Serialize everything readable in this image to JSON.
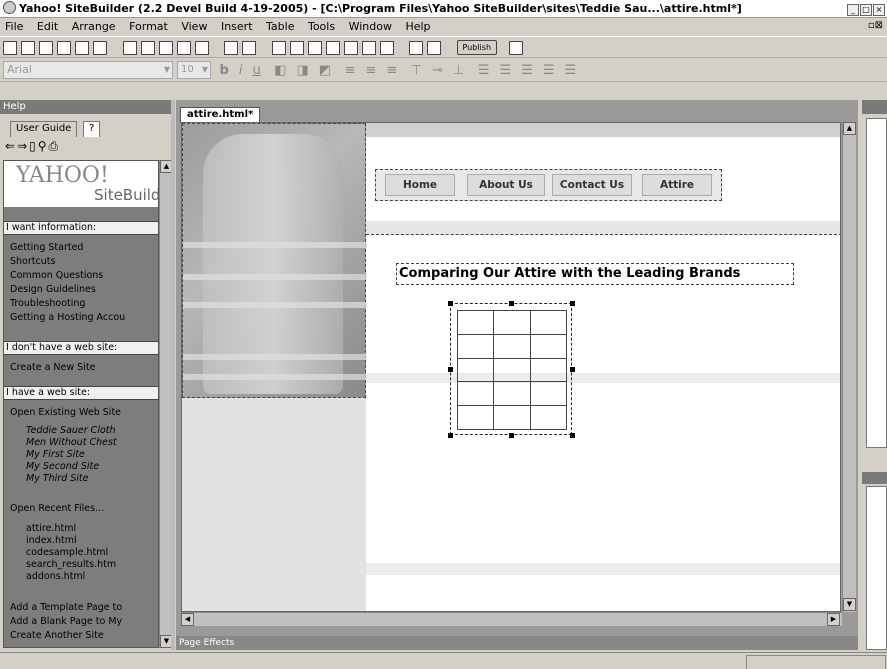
{
  "window": {
    "title": "Yahoo! SiteBuilder (2.2 Devel Build 4-19-2005) - [C:\\Program Files\\Yahoo SiteBuilder\\sites\\Teddie Sau...\\attire.html*]",
    "buttons": [
      "min",
      "max",
      "close"
    ]
  },
  "menu": {
    "items": [
      "File",
      "Edit",
      "Arrange",
      "Format",
      "View",
      "Insert",
      "Table",
      "Tools",
      "Window",
      "Help"
    ]
  },
  "toolbar": {
    "publish_label": "Publish"
  },
  "format_bar": {
    "font": "Arial",
    "size": "10"
  },
  "help_panel": {
    "title": "Help",
    "tabs": [
      "User Guide",
      "?"
    ],
    "logo_text": "YAHOO!",
    "logo_sub": "SiteBuild",
    "sections": [
      {
        "heading": "I want information:",
        "links": [
          "Getting Started",
          "Shortcuts",
          "Common Questions",
          "Design Guidelines",
          "Troubleshooting",
          "Getting a Hosting Accou"
        ]
      },
      {
        "heading": "I don't have a web site:",
        "links": [
          "Create a New Site"
        ]
      },
      {
        "heading": "I have a web site:",
        "links": [
          "Open Existing Web Site"
        ],
        "sites": [
          "Teddie Sauer Cloth",
          "Men Without Chest",
          "My First Site",
          "My Second Site",
          "My Third Site"
        ],
        "recent_label": "Open Recent Files...",
        "recent_files": [
          "attire.html",
          "index.html",
          "codesample.html",
          "search_results.htm",
          "addons.html"
        ],
        "actions": [
          "Add a Template Page to",
          "Add a Blank Page to My",
          "Create Another Site"
        ]
      }
    ]
  },
  "editor": {
    "tab_label": "attire.html*",
    "nav_buttons": [
      "Home",
      "About Us",
      "Contact Us",
      "Attire"
    ],
    "heading": "Comparing Our Attire with the Leading Brands",
    "table": {
      "rows": 5,
      "cols": 3
    }
  },
  "bottom_panel": {
    "title": "Page Effects"
  }
}
